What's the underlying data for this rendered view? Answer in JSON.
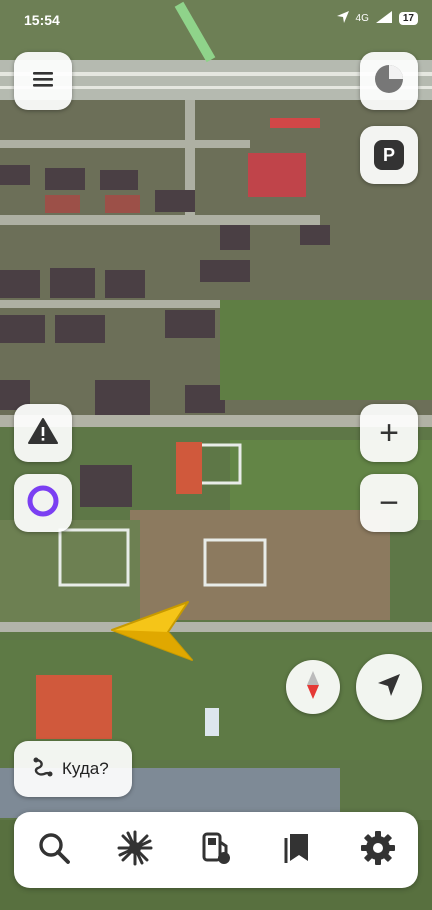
{
  "status_bar": {
    "time": "15:54",
    "network": "4G",
    "battery": "17"
  },
  "map": {
    "marker": "yellow-navigation-arrow"
  },
  "controls": {
    "menu": "menu-icon",
    "layers": "layers-icon",
    "parking": {
      "label": "P"
    },
    "report": "warning-icon",
    "alice": "alice-icon",
    "zoom_in": "+",
    "zoom_out": "−",
    "compass": "compass-icon",
    "my_location": "location-arrow-icon"
  },
  "destination": {
    "label": "Куда?"
  },
  "tabbar": {
    "items": [
      "search-icon",
      "discover-icon",
      "fuel-icon",
      "bookmarks-icon",
      "settings-icon"
    ]
  },
  "colors": {
    "accent_yellow": "#f5c518",
    "alice_purple": "#7b3ff2",
    "compass_red": "#e53935"
  }
}
